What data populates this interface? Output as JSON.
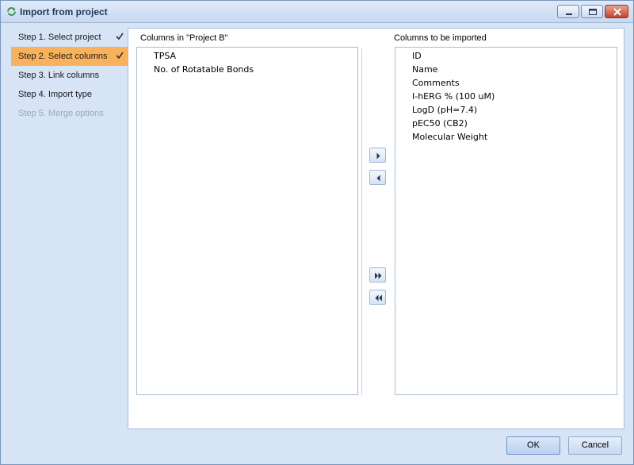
{
  "window": {
    "title": "Import from project"
  },
  "steps": [
    {
      "label": "Step 1. Select project",
      "state": "done"
    },
    {
      "label": "Step 2. Select columns",
      "state": "active"
    },
    {
      "label": "Step 3. Link columns",
      "state": "normal"
    },
    {
      "label": "Step 4. Import type",
      "state": "normal"
    },
    {
      "label": "Step 5. Merge options",
      "state": "disabled"
    }
  ],
  "left_panel": {
    "label": "Columns in \"Project B\"",
    "items": [
      "TPSA",
      "No. of Rotatable Bonds"
    ]
  },
  "right_panel": {
    "label": "Columns to be imported",
    "items": [
      "ID",
      "Name",
      "Comments",
      "I-hERG % (100 uM)",
      "LogD (pH=7.4)",
      "pEC50 (CB2)",
      "Molecular Weight"
    ]
  },
  "buttons": {
    "ok": "OK",
    "cancel": "Cancel"
  },
  "colors": {
    "active_step": "#f9b25c",
    "window_bg": "#d6e4f5"
  }
}
